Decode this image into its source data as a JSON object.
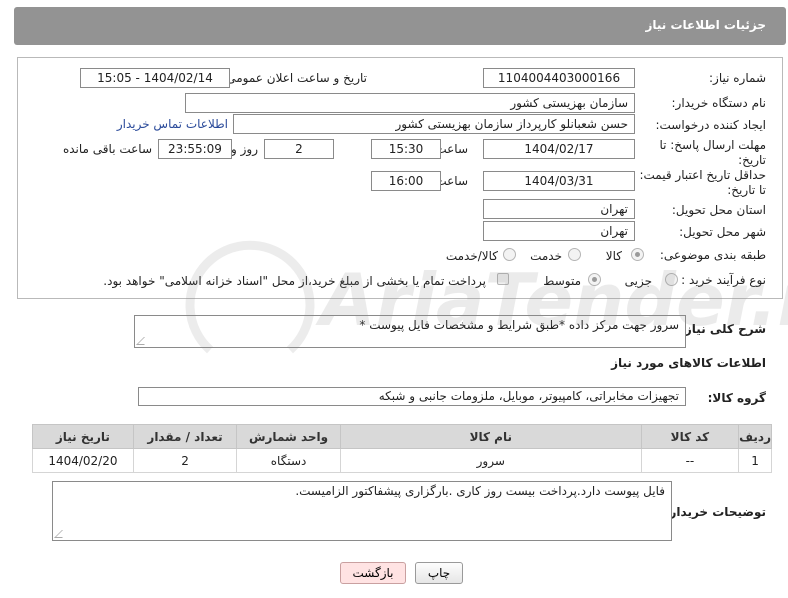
{
  "header": {
    "title": "جزئیات اطلاعات نیاز"
  },
  "form": {
    "need_number_label": "شماره نیاز:",
    "need_number": "1104004403000166",
    "announce_label": "تاریخ و ساعت اعلان عمومی:",
    "announce_value": "1404/02/14 - 15:05",
    "buyer_org_label": "نام دستگاه خریدار:",
    "buyer_org": "سازمان بهزیستی کشور",
    "creator_label": "ایجاد کننده درخواست:",
    "creator": "حسن  شعبانلو کارپرداز سازمان بهزیستی کشور",
    "contact_link": "اطلاعات تماس خریدار",
    "reply_deadline_label": "مهلت ارسال پاسخ: تا تاریخ:",
    "reply_date": "1404/02/17",
    "time_label": "ساعت",
    "reply_time": "15:30",
    "days_value": "2",
    "days_label": "روز و",
    "remaining_time": "23:55:09",
    "remaining_label": "ساعت باقی مانده",
    "price_validity_label": "حداقل تاریخ اعتبار قیمت: تا تاریخ:",
    "validity_date": "1404/03/31",
    "validity_time": "16:00",
    "province_label": "استان محل تحویل:",
    "province": "تهران",
    "city_label": "شهر محل تحویل:",
    "city": "تهران",
    "category_label": "طبقه بندی موضوعی:",
    "category_options": [
      "کالا",
      "خدمت",
      "کالا/خدمت"
    ],
    "process_label": "نوع فرآیند خرید :",
    "process_options": [
      "جزیی",
      "متوسط"
    ],
    "payment_note": "پرداخت تمام یا بخشی از مبلغ خرید،از محل \"اسناد خزانه اسلامی\" خواهد بود."
  },
  "description": {
    "label": "شرح کلی نیاز:",
    "text": "سرور جهت مرکز داده *طبق شرایط و مشخصات فایل پیوست *"
  },
  "goods": {
    "section_title": "اطلاعات کالاهای مورد نیاز",
    "group_label": "گروه کالا:",
    "group_value": "تجهیزات مخابراتی، کامپیوتر، موبایل، ملزومات جانبی و شبکه",
    "columns": [
      "ردیف",
      "کد کالا",
      "نام کالا",
      "واحد شمارش",
      "تعداد / مقدار",
      "تاریخ نیاز"
    ],
    "rows": [
      [
        "1",
        "--",
        "سرور",
        "دستگاه",
        "2",
        "1404/02/20"
      ]
    ]
  },
  "buyer_notes": {
    "label": "توضیحات خریدار:",
    "text": "فایل پیوست دارد.پرداخت بیست روز کاری .بارگزاری پیشفاکتور الزامیست."
  },
  "buttons": {
    "print": "چاپ",
    "back": "بازگشت"
  },
  "watermark": {
    "text": "AriaTender.neT"
  },
  "colors": {
    "header_bg": "#939393",
    "back_btn_bg": "#ffe3e3",
    "link": "#2a4a9a"
  }
}
